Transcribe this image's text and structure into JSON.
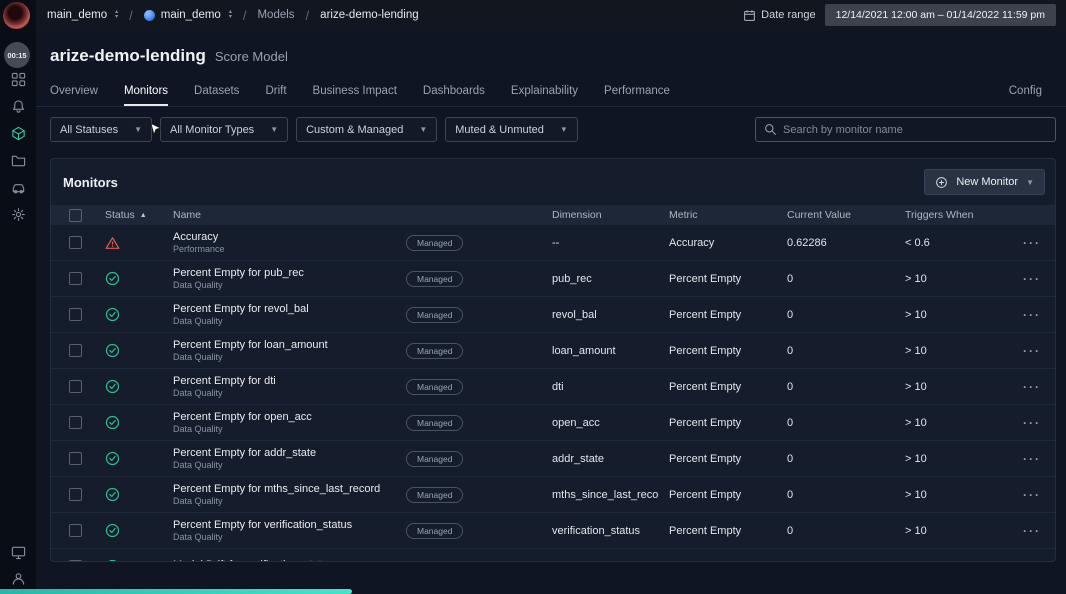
{
  "topbar": {
    "org": "main_demo",
    "space": "main_demo",
    "section": "Models",
    "model": "arize-demo-lending",
    "date_range_label": "Date range",
    "date_range_value": "12/14/2021 12:00 am – 01/14/2022 11:59 pm"
  },
  "sidebar": {
    "timer": "00:15"
  },
  "page": {
    "title": "arize-demo-lending",
    "subtitle": "Score Model"
  },
  "tabs": {
    "items": [
      "Overview",
      "Monitors",
      "Datasets",
      "Drift",
      "Business Impact",
      "Dashboards",
      "Explainability",
      "Performance"
    ],
    "active": "Monitors",
    "config": "Config"
  },
  "filters": {
    "status": "All Statuses",
    "types": "All Monitor Types",
    "managed": "Custom & Managed",
    "muted": "Muted & Unmuted",
    "search_placeholder": "Search by monitor name"
  },
  "monitors": {
    "title": "Monitors",
    "new_button": "New Monitor",
    "columns": {
      "status": "Status",
      "name": "Name",
      "dimension": "Dimension",
      "metric": "Metric",
      "current_value": "Current Value",
      "triggers_when": "Triggers When"
    },
    "rows": [
      {
        "status": "warning",
        "name": "Accuracy",
        "category": "Performance",
        "badge": "Managed",
        "dimension": "--",
        "metric": "Accuracy",
        "current_value": "0.62286",
        "triggers_when": "< 0.6"
      },
      {
        "status": "ok",
        "name": "Percent Empty for pub_rec",
        "category": "Data Quality",
        "badge": "Managed",
        "dimension": "pub_rec",
        "metric": "Percent Empty",
        "current_value": "0",
        "triggers_when": "> 10"
      },
      {
        "status": "ok",
        "name": "Percent Empty for revol_bal",
        "category": "Data Quality",
        "badge": "Managed",
        "dimension": "revol_bal",
        "metric": "Percent Empty",
        "current_value": "0",
        "triggers_when": "> 10"
      },
      {
        "status": "ok",
        "name": "Percent Empty for loan_amount",
        "category": "Data Quality",
        "badge": "Managed",
        "dimension": "loan_amount",
        "metric": "Percent Empty",
        "current_value": "0",
        "triggers_when": "> 10"
      },
      {
        "status": "ok",
        "name": "Percent Empty for dti",
        "category": "Data Quality",
        "badge": "Managed",
        "dimension": "dti",
        "metric": "Percent Empty",
        "current_value": "0",
        "triggers_when": "> 10"
      },
      {
        "status": "ok",
        "name": "Percent Empty for open_acc",
        "category": "Data Quality",
        "badge": "Managed",
        "dimension": "open_acc",
        "metric": "Percent Empty",
        "current_value": "0",
        "triggers_when": "> 10"
      },
      {
        "status": "ok",
        "name": "Percent Empty for addr_state",
        "category": "Data Quality",
        "badge": "Managed",
        "dimension": "addr_state",
        "metric": "Percent Empty",
        "current_value": "0",
        "triggers_when": "> 10"
      },
      {
        "status": "ok",
        "name": "Percent Empty for mths_since_last_record",
        "category": "Data Quality",
        "badge": "Managed",
        "dimension": "mths_since_last_record",
        "metric": "Percent Empty",
        "current_value": "0",
        "triggers_when": "> 10"
      },
      {
        "status": "ok",
        "name": "Percent Empty for verification_status",
        "category": "Data Quality",
        "badge": "Managed",
        "dimension": "verification_status",
        "metric": "Percent Empty",
        "current_value": "0",
        "triggers_when": "> 10"
      },
      {
        "status": "ok",
        "name": "Model Drift for verification_status",
        "category": "",
        "badge": "",
        "dimension": "",
        "metric": "",
        "current_value": "",
        "triggers_when": ""
      }
    ]
  },
  "colors": {
    "accent_teal": "#28b7a8",
    "accent_teal_light": "#43e6c9",
    "warning": "#e0614f",
    "ok": "#2fbf8f"
  }
}
